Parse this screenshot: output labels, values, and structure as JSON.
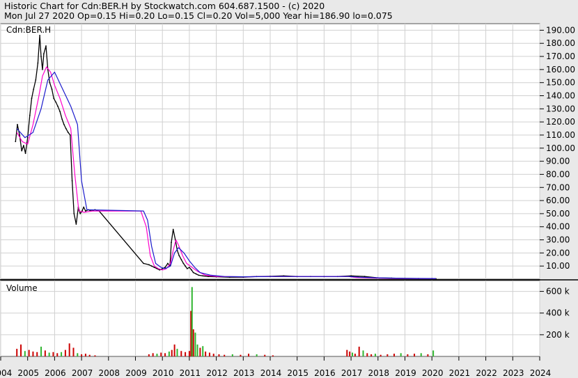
{
  "header": {
    "line1": "Historic Chart for Cdn:BER.H by Stockwatch.com 604.687.1500 - (c) 2020",
    "line2": "Mon Jul 27 2020   Op=0.15  Hi=0.20  Lo=0.15  Cl=0.20  Vol=5,000  Year hi=186.90  lo=0.075"
  },
  "chart_data": [
    {
      "type": "line",
      "title": "Cdn:BER.H",
      "x_unit": "year",
      "xlim": [
        2004,
        2024
      ],
      "ylim": [
        0,
        195
      ],
      "ytick_labels": [
        "10.00",
        "20.00",
        "30.00",
        "40.00",
        "50.00",
        "60.00",
        "70.00",
        "80.00",
        "90.00",
        "100.00",
        "110.00",
        "120.00",
        "130.00",
        "140.00",
        "150.00",
        "160.00",
        "170.00",
        "180.00",
        "190.00"
      ],
      "ytick_values": [
        10,
        20,
        30,
        40,
        50,
        60,
        70,
        80,
        90,
        100,
        110,
        120,
        130,
        140,
        150,
        160,
        170,
        180,
        190
      ],
      "xtick_labels": [
        "2004",
        "2005",
        "2006",
        "2007",
        "2008",
        "2009",
        "2010",
        "2011",
        "2012",
        "2013",
        "2014",
        "2015",
        "2016",
        "2017",
        "2018",
        "2019",
        "2020",
        "2021",
        "2022",
        "2023",
        "2024"
      ],
      "grid": true,
      "colors": {
        "price": "#000000",
        "ma_short": "#ff00cc",
        "ma_long": "#1a1acc",
        "frame": "#555555",
        "grid": "#d0d0d0"
      },
      "series": [
        {
          "role": "price",
          "x": [
            2004.55,
            2004.62,
            2004.7,
            2004.78,
            2004.85,
            2004.92,
            2005.0,
            2005.08,
            2005.15,
            2005.22,
            2005.3,
            2005.38,
            2005.45,
            2005.5,
            2005.55,
            2005.6,
            2005.68,
            2005.75,
            2005.82,
            2005.9,
            2005.97,
            2006.05,
            2006.12,
            2006.2,
            2006.28,
            2006.35,
            2006.42,
            2006.5,
            2006.58,
            2006.65,
            2006.72,
            2006.8,
            2006.88,
            2006.95,
            2007.02,
            2007.08,
            2007.15,
            2007.25,
            2007.35,
            2007.5,
            2007.65,
            2009.3,
            2009.5,
            2009.6,
            2009.7,
            2009.8,
            2009.9,
            2010.0,
            2010.1,
            2010.2,
            2010.28,
            2010.33,
            2010.4,
            2010.48,
            2010.55,
            2010.62,
            2010.7,
            2010.78,
            2010.85,
            2010.92,
            2011.0,
            2011.08,
            2011.15,
            2011.25,
            2011.35,
            2011.5,
            2011.7,
            2012.0,
            2012.5,
            2013.0,
            2013.5,
            2014.0,
            2014.5,
            2015.0,
            2015.5,
            2016.0,
            2016.5,
            2017.0,
            2017.5,
            2018.0,
            2018.5,
            2019.0,
            2019.5,
            2020.0,
            2020.15
          ],
          "y": [
            105,
            118,
            110,
            98,
            102,
            96,
            108,
            125,
            138,
            145,
            152,
            165,
            186,
            170,
            160,
            172,
            178,
            160,
            150,
            145,
            138,
            135,
            132,
            128,
            122,
            118,
            115,
            112,
            110,
            75,
            50,
            42,
            55,
            50,
            52,
            55,
            52,
            53,
            52,
            53,
            52,
            12,
            11,
            10,
            9,
            8,
            7,
            8,
            9,
            12,
            10,
            28,
            38,
            30,
            22,
            18,
            15,
            12,
            10,
            8,
            9,
            7,
            5,
            4,
            3,
            2.5,
            2,
            1.8,
            1.5,
            1.5,
            2,
            2.2,
            2.5,
            2,
            2,
            2,
            2,
            2.5,
            2,
            1,
            0.8,
            0.6,
            0.5,
            0.4,
            0.3
          ]
        },
        {
          "role": "ma_short",
          "x": [
            2004.6,
            2004.8,
            2005.0,
            2005.2,
            2005.4,
            2005.55,
            2005.7,
            2005.85,
            2006.0,
            2006.2,
            2006.4,
            2006.6,
            2006.75,
            2006.9,
            2007.1,
            2007.4,
            2009.2,
            2009.4,
            2009.55,
            2009.7,
            2009.85,
            2010.0,
            2010.15,
            2010.3,
            2010.4,
            2010.5,
            2010.6,
            2010.75,
            2010.9,
            2011.1,
            2011.3,
            2011.6,
            2012.0,
            2013.0,
            2014.0,
            2015.0,
            2016.0,
            2016.9,
            2017.2,
            2018.0,
            2019.0,
            2020.15
          ],
          "y": [
            112,
            105,
            103,
            118,
            138,
            155,
            162,
            158,
            148,
            138,
            125,
            115,
            80,
            52,
            51,
            52,
            52,
            40,
            18,
            10,
            8,
            7,
            8,
            12,
            22,
            30,
            26,
            18,
            12,
            9,
            6,
            3,
            2,
            1.8,
            2,
            2,
            2,
            2,
            1.2,
            0.8,
            0.5,
            0.4
          ]
        },
        {
          "role": "ma_long",
          "x": [
            2004.6,
            2004.9,
            2005.2,
            2005.5,
            2005.75,
            2006.0,
            2006.3,
            2006.6,
            2006.85,
            2007.0,
            2007.2,
            2009.3,
            2009.45,
            2009.6,
            2009.75,
            2009.95,
            2010.1,
            2010.3,
            2010.45,
            2010.6,
            2010.8,
            2011.0,
            2011.2,
            2011.4,
            2011.8,
            2012.3,
            2013.0,
            2014.0,
            2015.0,
            2016.0,
            2016.9,
            2017.3,
            2018.0,
            2019.0,
            2020.15
          ],
          "y": [
            115,
            108,
            112,
            130,
            152,
            158,
            145,
            132,
            118,
            75,
            53,
            52,
            45,
            25,
            12,
            9,
            8,
            10,
            20,
            24,
            20,
            14,
            9,
            5,
            3,
            2,
            1.8,
            2,
            2,
            2,
            2,
            1.5,
            1,
            0.6,
            0.5
          ]
        }
      ]
    },
    {
      "type": "bar",
      "title": "Volume",
      "xlim": [
        2004,
        2024
      ],
      "ylim": [
        0,
        700
      ],
      "ytick_labels": [
        "200 k",
        "400 k",
        "600 k"
      ],
      "ytick_values": [
        200,
        400,
        600
      ],
      "colors": {
        "up": "#2fb52f",
        "down": "#cc0000"
      },
      "bars": [
        {
          "x": 2004.6,
          "v": 70,
          "d": "down"
        },
        {
          "x": 2004.75,
          "v": 110,
          "d": "down"
        },
        {
          "x": 2004.9,
          "v": 50,
          "d": "up"
        },
        {
          "x": 2005.05,
          "v": 60,
          "d": "down"
        },
        {
          "x": 2005.2,
          "v": 45,
          "d": "down"
        },
        {
          "x": 2005.35,
          "v": 40,
          "d": "down"
        },
        {
          "x": 2005.5,
          "v": 90,
          "d": "up"
        },
        {
          "x": 2005.65,
          "v": 55,
          "d": "down"
        },
        {
          "x": 2005.8,
          "v": 35,
          "d": "up"
        },
        {
          "x": 2005.95,
          "v": 40,
          "d": "down"
        },
        {
          "x": 2006.1,
          "v": 30,
          "d": "down"
        },
        {
          "x": 2006.25,
          "v": 40,
          "d": "up"
        },
        {
          "x": 2006.4,
          "v": 60,
          "d": "down"
        },
        {
          "x": 2006.55,
          "v": 120,
          "d": "down"
        },
        {
          "x": 2006.7,
          "v": 80,
          "d": "down"
        },
        {
          "x": 2006.85,
          "v": 30,
          "d": "up"
        },
        {
          "x": 2007.0,
          "v": 20,
          "d": "down"
        },
        {
          "x": 2007.15,
          "v": 25,
          "d": "down"
        },
        {
          "x": 2007.3,
          "v": 15,
          "d": "down"
        },
        {
          "x": 2007.5,
          "v": 10,
          "d": "down"
        },
        {
          "x": 2009.5,
          "v": 20,
          "d": "down"
        },
        {
          "x": 2009.65,
          "v": 30,
          "d": "down"
        },
        {
          "x": 2009.8,
          "v": 25,
          "d": "up"
        },
        {
          "x": 2009.95,
          "v": 35,
          "d": "down"
        },
        {
          "x": 2010.1,
          "v": 30,
          "d": "down"
        },
        {
          "x": 2010.25,
          "v": 45,
          "d": "up"
        },
        {
          "x": 2010.35,
          "v": 60,
          "d": "down"
        },
        {
          "x": 2010.45,
          "v": 110,
          "d": "down"
        },
        {
          "x": 2010.55,
          "v": 70,
          "d": "up"
        },
        {
          "x": 2010.7,
          "v": 50,
          "d": "down"
        },
        {
          "x": 2010.85,
          "v": 40,
          "d": "down"
        },
        {
          "x": 2011.0,
          "v": 50,
          "d": "down"
        },
        {
          "x": 2011.06,
          "v": 420,
          "d": "down"
        },
        {
          "x": 2011.1,
          "v": 640,
          "d": "up"
        },
        {
          "x": 2011.15,
          "v": 250,
          "d": "down"
        },
        {
          "x": 2011.22,
          "v": 220,
          "d": "up"
        },
        {
          "x": 2011.3,
          "v": 110,
          "d": "up"
        },
        {
          "x": 2011.4,
          "v": 80,
          "d": "down"
        },
        {
          "x": 2011.5,
          "v": 95,
          "d": "up"
        },
        {
          "x": 2011.6,
          "v": 45,
          "d": "down"
        },
        {
          "x": 2011.75,
          "v": 35,
          "d": "down"
        },
        {
          "x": 2011.9,
          "v": 25,
          "d": "down"
        },
        {
          "x": 2012.1,
          "v": 20,
          "d": "down"
        },
        {
          "x": 2012.3,
          "v": 15,
          "d": "down"
        },
        {
          "x": 2012.6,
          "v": 20,
          "d": "up"
        },
        {
          "x": 2012.9,
          "v": 15,
          "d": "down"
        },
        {
          "x": 2013.2,
          "v": 25,
          "d": "down"
        },
        {
          "x": 2013.5,
          "v": 20,
          "d": "up"
        },
        {
          "x": 2013.8,
          "v": 15,
          "d": "down"
        },
        {
          "x": 2014.1,
          "v": 10,
          "d": "down"
        },
        {
          "x": 2016.85,
          "v": 60,
          "d": "down"
        },
        {
          "x": 2016.95,
          "v": 45,
          "d": "down"
        },
        {
          "x": 2017.05,
          "v": 35,
          "d": "up"
        },
        {
          "x": 2017.15,
          "v": 25,
          "d": "down"
        },
        {
          "x": 2017.3,
          "v": 90,
          "d": "down"
        },
        {
          "x": 2017.45,
          "v": 55,
          "d": "up"
        },
        {
          "x": 2017.6,
          "v": 30,
          "d": "down"
        },
        {
          "x": 2017.75,
          "v": 20,
          "d": "down"
        },
        {
          "x": 2017.9,
          "v": 25,
          "d": "up"
        },
        {
          "x": 2018.1,
          "v": 15,
          "d": "down"
        },
        {
          "x": 2018.35,
          "v": 20,
          "d": "down"
        },
        {
          "x": 2018.6,
          "v": 25,
          "d": "down"
        },
        {
          "x": 2018.85,
          "v": 30,
          "d": "up"
        },
        {
          "x": 2019.1,
          "v": 20,
          "d": "down"
        },
        {
          "x": 2019.35,
          "v": 25,
          "d": "down"
        },
        {
          "x": 2019.6,
          "v": 30,
          "d": "up"
        },
        {
          "x": 2019.85,
          "v": 20,
          "d": "down"
        },
        {
          "x": 2020.05,
          "v": 55,
          "d": "up"
        }
      ]
    }
  ]
}
